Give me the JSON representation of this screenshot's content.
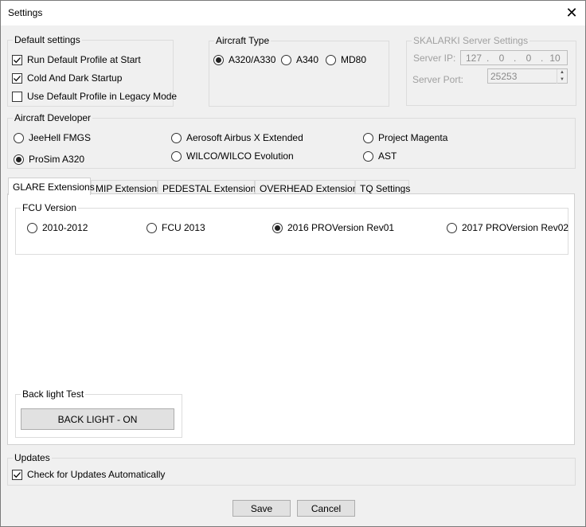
{
  "window": {
    "title": "Settings",
    "close_glyph": "✕"
  },
  "default_settings": {
    "title": "Default settings",
    "items": [
      {
        "label": "Run Default Profile at Start",
        "checked": true
      },
      {
        "label": "Cold And Dark Startup",
        "checked": true
      },
      {
        "label": "Use Default Profile in Legacy Mode",
        "checked": false
      }
    ]
  },
  "aircraft_type": {
    "title": "Aircraft Type",
    "options": [
      {
        "label": "A320/A330",
        "selected": true
      },
      {
        "label": "A340",
        "selected": false
      },
      {
        "label": "MD80",
        "selected": false
      }
    ]
  },
  "server": {
    "title": "SKALARKI Server Settings",
    "ip_label": "Server IP:",
    "ip": [
      "127",
      "0",
      "0",
      "10"
    ],
    "port_label": "Server Port:",
    "port": "25253"
  },
  "developer": {
    "title": "Aircraft Developer",
    "options": [
      {
        "label": "JeeHell FMGS",
        "selected": false
      },
      {
        "label": "Aerosoft Airbus X Extended",
        "selected": false
      },
      {
        "label": "Project Magenta",
        "selected": false
      },
      {
        "label": "ProSim A320",
        "selected": true
      },
      {
        "label": "WILCO/WILCO Evolution",
        "selected": false
      },
      {
        "label": "AST",
        "selected": false
      }
    ]
  },
  "tabs": [
    {
      "label": "GLARE Extensions",
      "active": true
    },
    {
      "label": "MIP Extensions",
      "active": false
    },
    {
      "label": "PEDESTAL Extensions",
      "active": false
    },
    {
      "label": "OVERHEAD Extensions",
      "active": false
    },
    {
      "label": "TQ Settings",
      "active": false
    }
  ],
  "fcu": {
    "title": "FCU Version",
    "options": [
      {
        "label": "2010-2012",
        "selected": false
      },
      {
        "label": "FCU 2013",
        "selected": false
      },
      {
        "label": "2016 PROVersion Rev01",
        "selected": true
      },
      {
        "label": "2017 PROVersion Rev02",
        "selected": false
      }
    ]
  },
  "backlight": {
    "title": "Back light Test",
    "button_label": "BACK LIGHT - ON"
  },
  "updates": {
    "title": "Updates",
    "check_label": "Check for Updates Automatically",
    "checked": true
  },
  "footer": {
    "save_label": "Save",
    "cancel_label": "Cancel"
  }
}
